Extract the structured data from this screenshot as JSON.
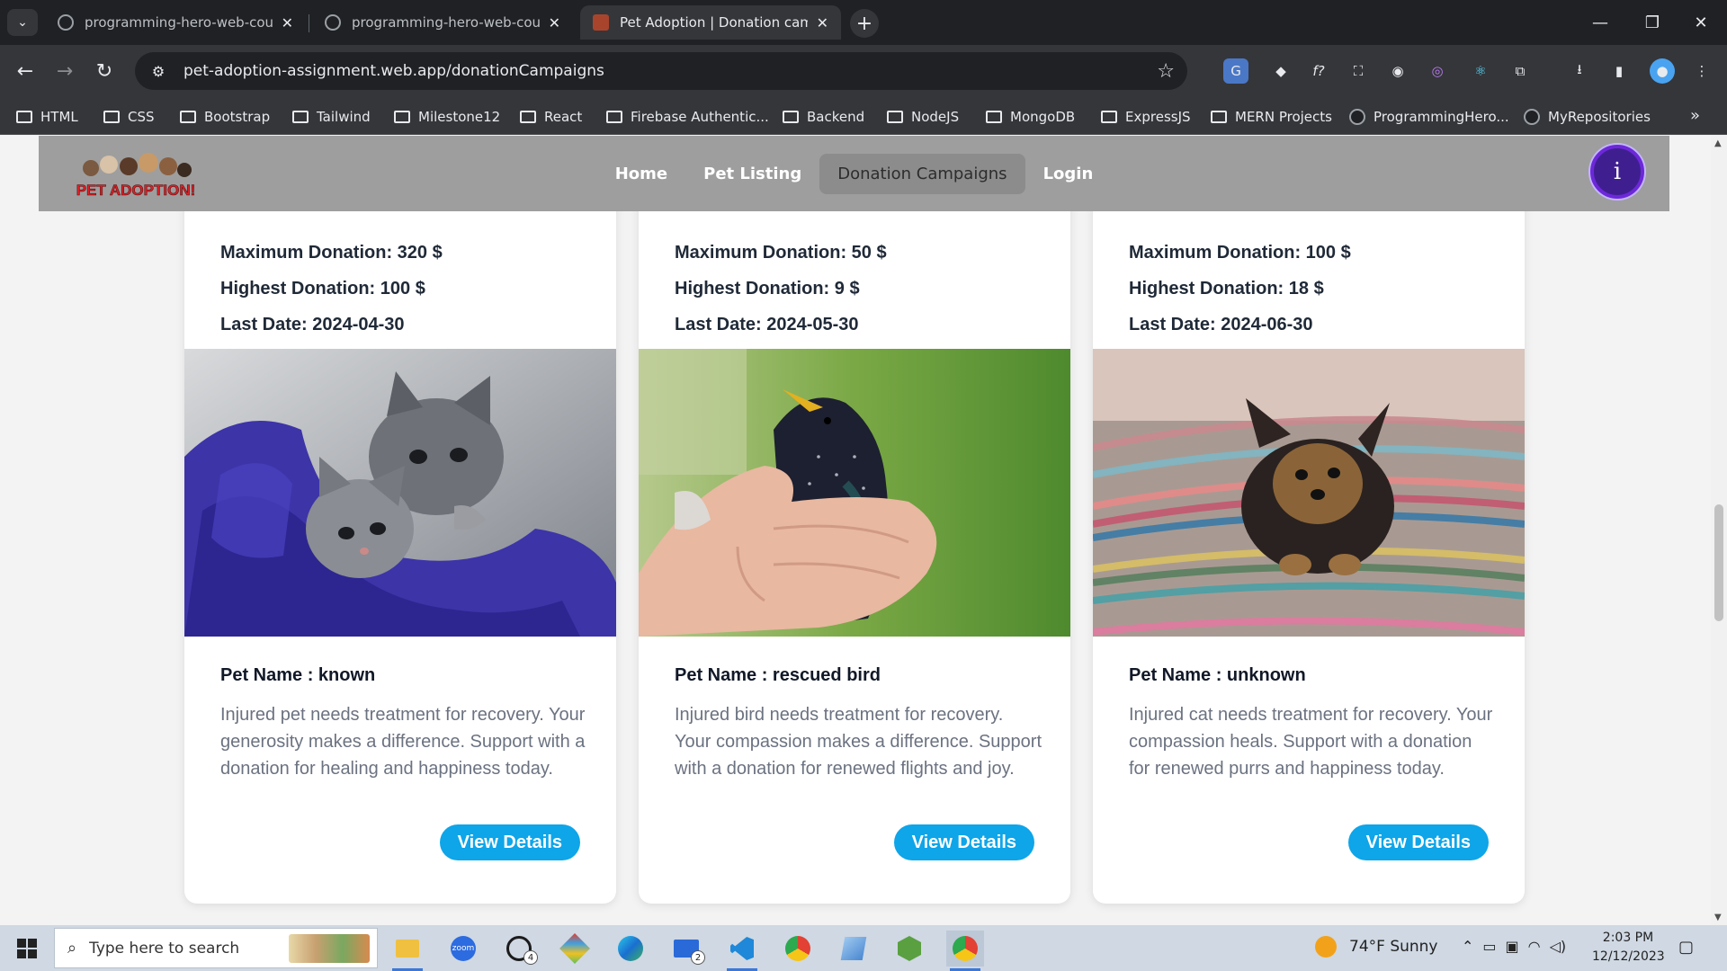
{
  "browser": {
    "tabs": [
      {
        "title": "programming-hero-web-course",
        "active": false
      },
      {
        "title": "programming-hero-web-course",
        "active": false
      },
      {
        "title": "Pet Adoption | Donation campaigns",
        "active": true
      }
    ],
    "url": "pet-adoption-assignment.web.app/donationCampaigns",
    "bookmarks": [
      {
        "label": "HTML",
        "type": "folder"
      },
      {
        "label": "CSS",
        "type": "folder"
      },
      {
        "label": "Bootstrap",
        "type": "folder"
      },
      {
        "label": "Tailwind",
        "type": "folder"
      },
      {
        "label": "Milestone12",
        "type": "folder"
      },
      {
        "label": "React",
        "type": "folder"
      },
      {
        "label": "Firebase Authentic...",
        "type": "folder"
      },
      {
        "label": "Backend",
        "type": "folder"
      },
      {
        "label": "NodeJS",
        "type": "folder"
      },
      {
        "label": "MongoDB",
        "type": "folder"
      },
      {
        "label": "ExpressJS",
        "type": "folder"
      },
      {
        "label": "MERN Projects",
        "type": "folder"
      },
      {
        "label": "ProgrammingHero...",
        "type": "github"
      },
      {
        "label": "MyRepositories",
        "type": "github"
      }
    ]
  },
  "site": {
    "logo_text": "PET ADOPTION!",
    "nav": [
      {
        "label": "Home",
        "active": false
      },
      {
        "label": "Pet Listing",
        "active": false
      },
      {
        "label": "Donation Campaigns",
        "active": true
      },
      {
        "label": "Login",
        "active": false
      }
    ],
    "avatar_letter": "i"
  },
  "campaigns": [
    {
      "max": "Maximum Donation: 320 $",
      "highest": "Highest Donation: 100 $",
      "last_date": "Last Date: 2024-04-30",
      "pet_name": "Pet Name : known",
      "description": "Injured pet needs treatment for recovery. Your generosity makes a difference. Support with a donation for healing and happiness today.",
      "button": "View Details",
      "image": "kittens-in-blue-towel"
    },
    {
      "max": "Maximum Donation: 50 $",
      "highest": "Highest Donation: 9 $",
      "last_date": "Last Date: 2024-05-30",
      "pet_name": "Pet Name : rescued bird",
      "description": "Injured bird needs treatment for recovery. Your compassion makes a difference. Support with a donation for renewed flights and joy.",
      "button": "View Details",
      "image": "starling-in-hand"
    },
    {
      "max": "Maximum Donation: 100 $",
      "highest": "Highest Donation: 18 $",
      "last_date": "Last Date: 2024-06-30",
      "pet_name": "Pet Name : unknown",
      "description": "Injured cat needs treatment for recovery. Your compassion heals. Support with a donation for renewed purrs and happiness today.",
      "button": "View Details",
      "image": "puppy-on-rug"
    }
  ],
  "taskbar": {
    "search_placeholder": "Type here to search",
    "weather": "74°F  Sunny",
    "time": "2:03 PM",
    "date": "12/12/2023",
    "whatsapp_badge": "4",
    "mail_badge": "2"
  }
}
